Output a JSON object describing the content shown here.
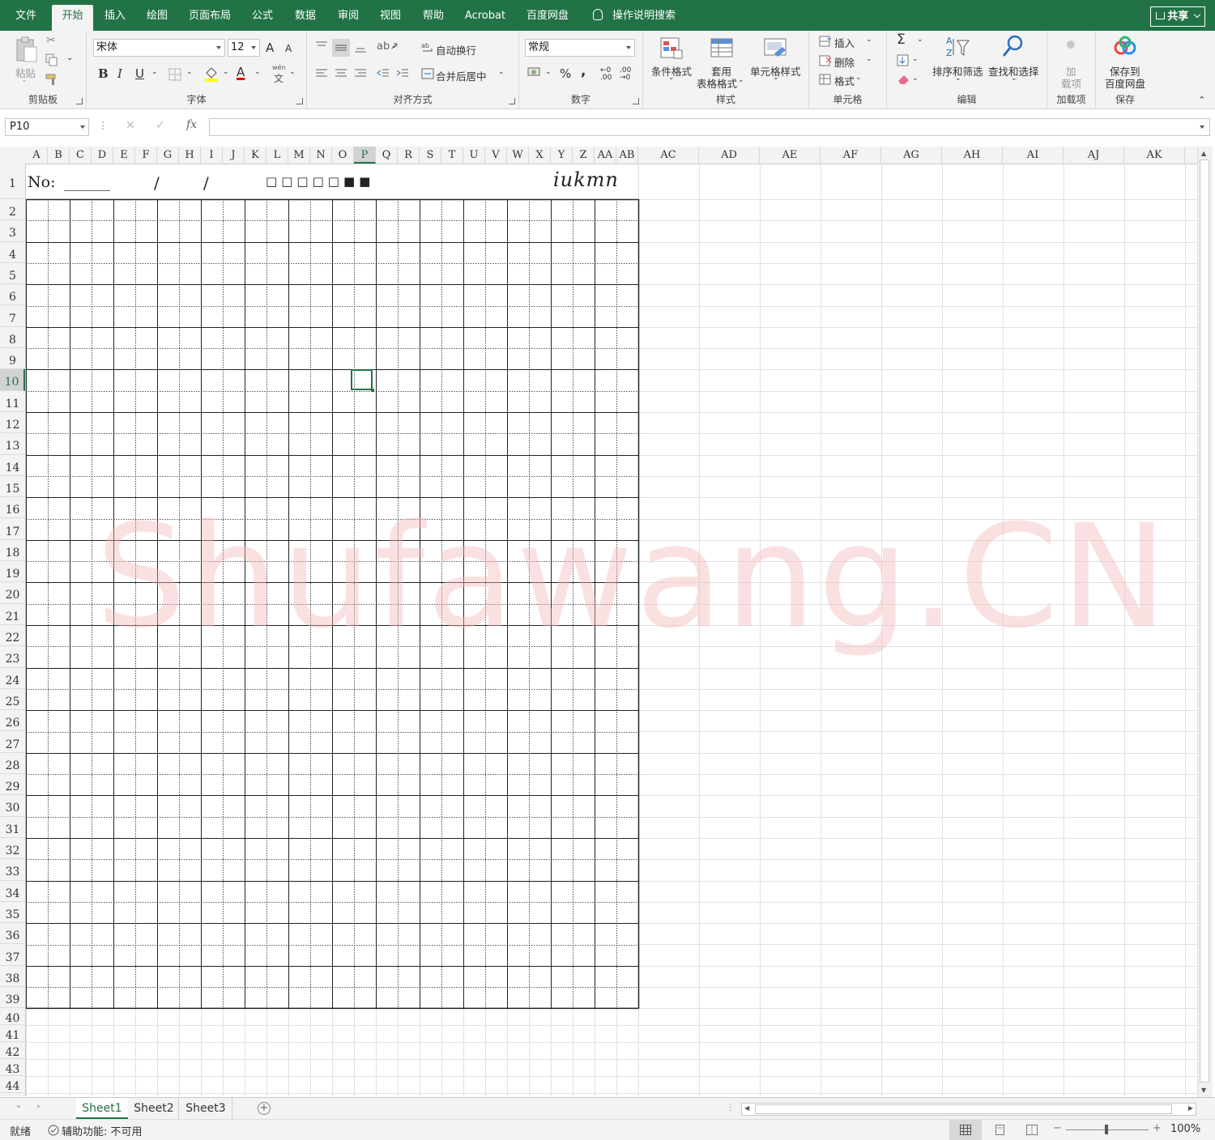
{
  "menu": {
    "tabs": [
      {
        "label": "文件",
        "active": false
      },
      {
        "label": "开始",
        "active": true
      },
      {
        "label": "插入",
        "active": false
      },
      {
        "label": "绘图",
        "active": false
      },
      {
        "label": "页面布局",
        "active": false
      },
      {
        "label": "公式",
        "active": false
      },
      {
        "label": "数据",
        "active": false
      },
      {
        "label": "审阅",
        "active": false
      },
      {
        "label": "视图",
        "active": false
      },
      {
        "label": "帮助",
        "active": false
      },
      {
        "label": "Acrobat",
        "active": false
      },
      {
        "label": "百度网盘",
        "active": false
      }
    ],
    "tell_me": "操作说明搜索",
    "share": "共享"
  },
  "ribbon": {
    "clipboard": {
      "label": "剪贴板",
      "paste": "粘贴"
    },
    "font": {
      "label": "字体",
      "name": "宋体",
      "size": "12",
      "bold": "B",
      "italic": "I",
      "underline": "U",
      "grow": "A",
      "shrink": "A",
      "phonetic_top": "wén",
      "phonetic_bottom": "文",
      "font_color_letter": "A"
    },
    "alignment": {
      "label": "对齐方式",
      "wrap": "自动换行",
      "merge": "合并后居中"
    },
    "number": {
      "label": "数字",
      "format": "常规",
      "percent": "%",
      "comma": ",",
      "inc_dec": "←0 .00",
      "dec_dec": ".00 →0"
    },
    "styles": {
      "label": "样式",
      "conditional": "条件格式",
      "table_line1": "套用",
      "table_line2": "表格格式",
      "cell_styles": "单元格样式"
    },
    "cells": {
      "label": "单元格",
      "insert": "插入",
      "delete": "删除",
      "format": "格式"
    },
    "editing": {
      "label": "编辑",
      "sum": "Σ",
      "sort": "排序和筛选",
      "find": "查找和选择"
    },
    "addins": {
      "label": "加载项",
      "line1": "加",
      "line2": "载项"
    },
    "save": {
      "label": "保存",
      "line1": "保存到",
      "line2": "百度网盘"
    }
  },
  "formula_bar": {
    "name_box": "P10",
    "fx": "fx",
    "cancel": "✕",
    "enter": "✓",
    "value": ""
  },
  "sheet": {
    "columns_narrow": [
      "A",
      "B",
      "C",
      "D",
      "E",
      "F",
      "G",
      "H",
      "I",
      "J",
      "K",
      "L",
      "M",
      "N",
      "O",
      "P",
      "Q",
      "R",
      "S",
      "T",
      "U",
      "V",
      "W",
      "X",
      "Y",
      "Z",
      "AA",
      "AB"
    ],
    "columns_wide": [
      "AC",
      "AD",
      "AE",
      "AF",
      "AG",
      "AH",
      "AI",
      "AJ",
      "AK"
    ],
    "rows": [
      "1",
      "2",
      "3",
      "4",
      "5",
      "6",
      "7",
      "8",
      "9",
      "10",
      "11",
      "12",
      "13",
      "14",
      "15",
      "16",
      "17",
      "18",
      "19",
      "20",
      "21",
      "22",
      "23",
      "24",
      "25",
      "26",
      "27",
      "28",
      "29",
      "30",
      "31",
      "32",
      "33",
      "34",
      "35",
      "36",
      "37",
      "38",
      "39",
      "40",
      "41",
      "42",
      "43",
      "44"
    ],
    "selected_column": "P",
    "selected_row": "10",
    "header_row": {
      "no_label": "No:",
      "blank": "______",
      "slash1": "/",
      "slash2": "/",
      "squares": [
        "□",
        "□",
        "□",
        "□",
        "□",
        "■",
        "■"
      ],
      "signature": "iukmn"
    },
    "watermark": "Shufawang.CN"
  },
  "sheet_tabs": [
    {
      "label": "Sheet1",
      "active": true
    },
    {
      "label": "Sheet2",
      "active": false
    },
    {
      "label": "Sheet3",
      "active": false
    }
  ],
  "status": {
    "ready": "就绪",
    "accessibility": "辅助功能: 不可用",
    "zoom": "100%"
  },
  "colors": {
    "brand": "#217346",
    "grid_line": "#222222",
    "watermark": "#f5b8b8"
  }
}
